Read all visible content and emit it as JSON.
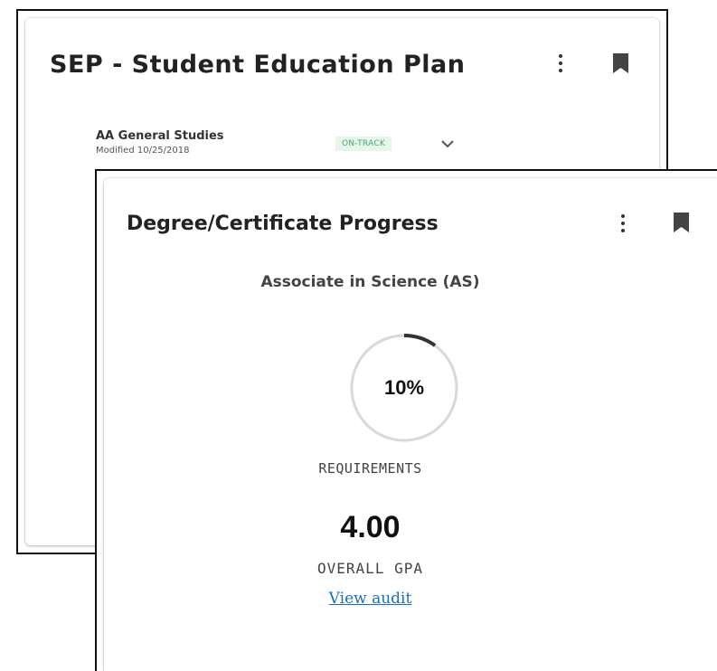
{
  "sep_card": {
    "title": "SEP - Student Education Plan",
    "menu_icon": "kebab-menu-icon",
    "bookmark_icon": "bookmark-icon",
    "plan": {
      "name": "AA General Studies",
      "modified": "Modified 10/25/2018",
      "status": "ON-TRACK",
      "status_color": "#4aa86c",
      "expand_icon": "chevron-down-icon"
    }
  },
  "degree_card": {
    "title": "Degree/Certificate Progress",
    "menu_icon": "kebab-menu-icon",
    "bookmark_icon": "bookmark-icon",
    "degree": "Associate in Science (AS)",
    "progress_percent": 10,
    "progress_label": "10%",
    "requirements_label": "REQUIREMENTS",
    "gpa": "4.00",
    "gpa_label": "OVERALL GPA",
    "audit_link": "View audit",
    "link_color": "#1a6fc4"
  }
}
